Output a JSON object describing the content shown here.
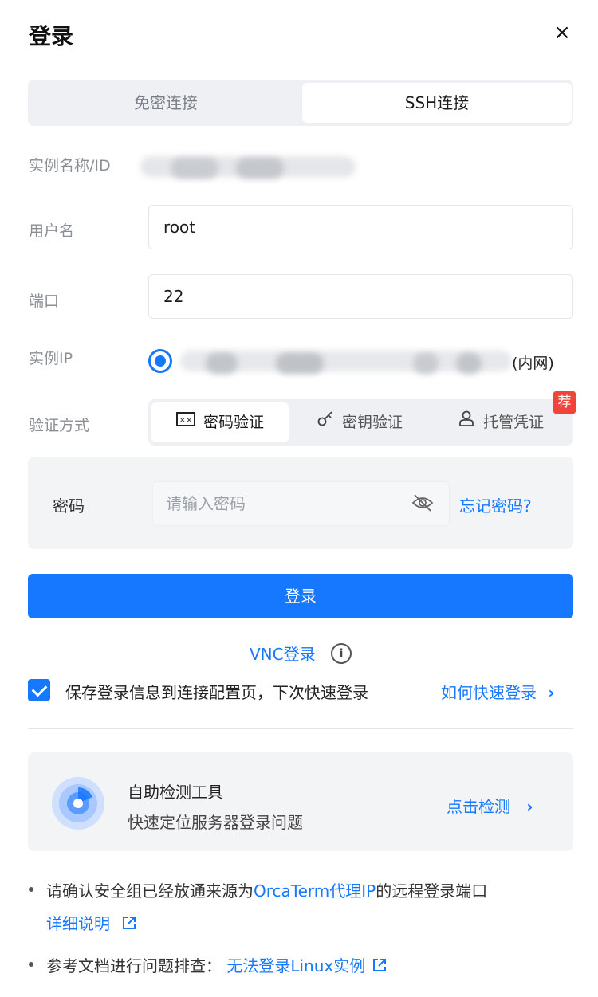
{
  "header": {
    "title": "登录",
    "close_symbol": "×"
  },
  "connection_tabs": [
    {
      "label": "免密连接",
      "active": false
    },
    {
      "label": "SSH连接",
      "active": true
    }
  ],
  "form": {
    "instance_label": "实例名称/ID",
    "username_label": "用户名",
    "username_value": "root",
    "port_label": "端口",
    "port_value": "22",
    "ip_label": "实例IP",
    "ip_suffix": "(内网)",
    "auth_label": "验证方式",
    "auth_methods": [
      {
        "icon": "password-icon",
        "label": "密码验证",
        "active": true
      },
      {
        "icon": "key-icon",
        "label": "密钥验证",
        "active": false
      },
      {
        "icon": "user-icon",
        "label": "托管凭证",
        "active": false
      }
    ],
    "recommend_badge": "荐",
    "password_label": "密码",
    "password_placeholder": "请输入密码",
    "forgot_password": "忘记密码?"
  },
  "actions": {
    "login_button": "登录",
    "vnc_login": "VNC登录",
    "save_checkbox_checked": true,
    "save_text": "保存登录信息到连接配置页，下次快速登录",
    "howto_link": "如何快速登录"
  },
  "tool": {
    "title": "自助检测工具",
    "subtitle": "快速定位服务器登录问题",
    "link": "点击检测"
  },
  "notes": [
    {
      "prefix": "请确认安全组已经放通来源为",
      "highlight": "OrcaTerm代理IP",
      "suffix": "的远程登录端口",
      "link": "详细说明"
    },
    {
      "prefix": "参考文档进行问题排查：",
      "link": "无法登录Linux实例"
    }
  ],
  "colors": {
    "accent": "#1677ff",
    "badge": "#f0443a"
  }
}
